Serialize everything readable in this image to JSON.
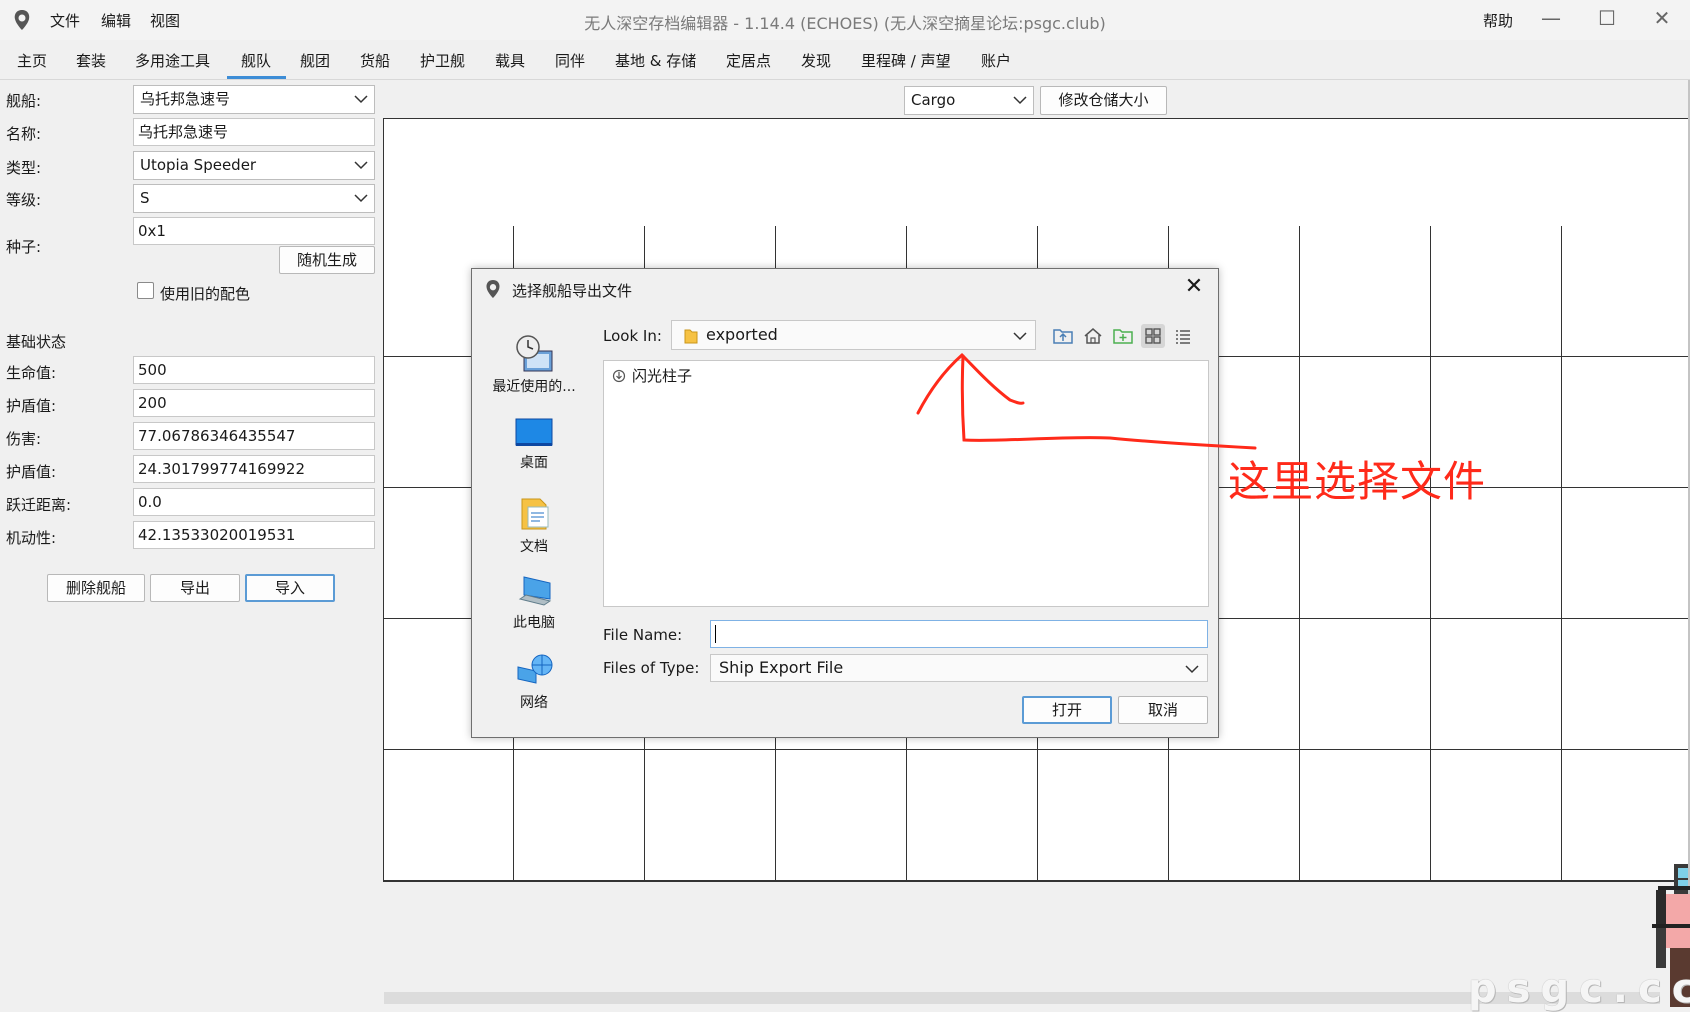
{
  "titlebar": {
    "menus": [
      "文件",
      "编辑",
      "视图"
    ],
    "title": "无人深空存档编辑器 - 1.14.4 (ECHOES) (无人深空摘星论坛:psgc.club)",
    "help": "帮助"
  },
  "tabs": [
    "主页",
    "套装",
    "多用途工具",
    "舰队",
    "舰团",
    "货船",
    "护卫舰",
    "载具",
    "同伴",
    "基地 & 存储",
    "定居点",
    "发现",
    "里程碑 / 声望",
    "账户"
  ],
  "active_tab": "舰队",
  "form": {
    "ship_label": "舰船:",
    "ship_value": "乌托邦急速号",
    "name_label": "名称:",
    "name_value": "乌托邦急速号",
    "type_label": "类型:",
    "type_value": "Utopia Speeder",
    "class_label": "等级:",
    "class_value": "S",
    "seed_label": "种子:",
    "seed_value": "0x1",
    "random_button": "随机生成",
    "old_colors_label": "使用旧的配色",
    "base_stats_label": "基础状态",
    "health_label": "生命值:",
    "health_value": "500",
    "shield_label": "护盾值:",
    "shield_value": "200",
    "damage_label": "伤害:",
    "damage_value": "77.06786346435547",
    "shield2_label": "护盾值:",
    "shield2_value": "24.301799774169922",
    "hyperdrive_label": "跃迁距离:",
    "hyperdrive_value": "0.0",
    "maneuver_label": "机动性:",
    "maneuver_value": "42.13533020019531",
    "delete_button": "删除舰船",
    "export_button": "导出",
    "import_button": "导入"
  },
  "inventory": {
    "type_value": "Cargo",
    "resize_button": "修改仓储大小"
  },
  "dialog": {
    "title": "选择舰船导出文件",
    "places": [
      "最近使用的...",
      "桌面",
      "文档",
      "此电脑",
      "网络"
    ],
    "look_in_label": "Look In:",
    "look_in_value": "exported",
    "files": [
      "闪光柱子"
    ],
    "file_name_label": "File Name:",
    "file_name_value": "",
    "files_of_type_label": "Files of Type:",
    "files_of_type_value": "Ship Export File",
    "open_button": "打开",
    "cancel_button": "取消"
  },
  "annotation": {
    "text": "这里选择文件",
    "color": "#ff2a1a"
  },
  "watermark": "psgc.cc",
  "colors": {
    "accent": "#3d8dd6",
    "annotation": "#ff2a1a"
  }
}
